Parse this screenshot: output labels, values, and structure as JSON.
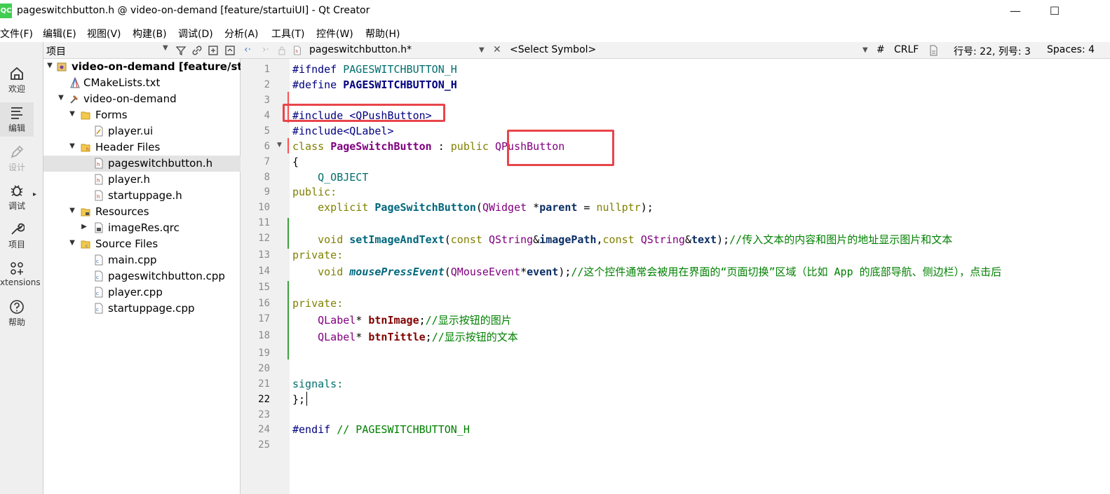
{
  "window": {
    "icon_text": "QC",
    "title": "pageswitchbutton.h @ video-on-demand [feature/startuiUI] - Qt Creator",
    "minimize": "—",
    "maximize": "☐"
  },
  "menu": [
    "文件(F)",
    "编辑(E)",
    "视图(V)",
    "构建(B)",
    "调试(D)",
    "分析(A)",
    "工具(T)",
    "控件(W)",
    "帮助(H)"
  ],
  "modes": [
    {
      "label": "欢迎",
      "icon": "home-icon"
    },
    {
      "label": "编辑",
      "icon": "edit-lines-icon"
    },
    {
      "label": "设计",
      "icon": "pen-icon"
    },
    {
      "label": "调试",
      "icon": "bug-icon"
    },
    {
      "label": "项目",
      "icon": "wrench-icon"
    },
    {
      "label": "xtensions",
      "icon": "extensions-icon"
    },
    {
      "label": "帮助",
      "icon": "help-icon"
    }
  ],
  "project_panel": {
    "combo_label": "项目",
    "tree": [
      {
        "label": "video-on-demand [feature/startuiUI]",
        "bold": true
      },
      {
        "label": "CMakeLists.txt"
      },
      {
        "label": "video-on-demand"
      },
      {
        "label": "Forms"
      },
      {
        "label": "player.ui"
      },
      {
        "label": "Header Files"
      },
      {
        "label": "pageswitchbutton.h",
        "selected": true
      },
      {
        "label": "player.h"
      },
      {
        "label": "startuppage.h"
      },
      {
        "label": "Resources"
      },
      {
        "label": "imageRes.qrc"
      },
      {
        "label": "Source Files"
      },
      {
        "label": "main.cpp"
      },
      {
        "label": "pageswitchbutton.cpp"
      },
      {
        "label": "player.cpp"
      },
      {
        "label": "startuppage.cpp"
      }
    ]
  },
  "editor_toolbar": {
    "file_name": "pageswitchbutton.h*",
    "symbol": "<Select Symbol>",
    "hash": "#",
    "line_ending": "CRLF",
    "position": "行号: 22, 列号: 3",
    "indent": "Spaces: 4"
  },
  "editor": {
    "current_line": 22,
    "line_numbers": [
      "1",
      "2",
      "3",
      "4",
      "5",
      "6",
      "7",
      "8",
      "9",
      "10",
      "11",
      "12",
      "13",
      "14",
      "15",
      "16",
      "17",
      "18",
      "19",
      "20",
      "21",
      "22",
      "23",
      "24",
      "25"
    ],
    "code": {
      "l1_kw": "#ifndef",
      "l1_name": " PAGESWITCHBUTTON_H",
      "l2_kw": "#define",
      "l2_name": " PAGESWITCHBUTTON_H",
      "l4": "#include <QPushButton>",
      "l5": "#include<QLabel>",
      "l6_kw": "class",
      "l6_name": "PageSwitchButton",
      "l6_mid": " : ",
      "l6_pub": "public",
      "l6_base": "QPushButton",
      "l7": "{",
      "l8": "    Q_OBJECT",
      "l9": "public:",
      "l10_kw": "    explicit",
      "l10_fn": "PageSwitchButton",
      "l10_p1": "(",
      "l10_type": "QWidget",
      "l10_p2": " *",
      "l10_var": "parent",
      "l10_p3": " = ",
      "l10_null": "nullptr",
      "l10_end": ");",
      "l12_kw": "    void",
      "l12_fn": "setImageAndText",
      "l12_p1": "(",
      "l12_const1": "const",
      "l12_type1": "QString",
      "l12_amp1": "&",
      "l12_var1": "imagePath",
      "l12_comma": ",",
      "l12_const2": "const",
      "l12_type2": "QString",
      "l12_amp2": "&",
      "l12_var2": "text",
      "l12_end": ");",
      "l12_cmt": "//传入文本的内容和图片的地址显示图片和文本",
      "l13": "private:",
      "l14_kw": "    void",
      "l14_fn": "mousePressEvent",
      "l14_p1": "(",
      "l14_type": "QMouseEvent",
      "l14_star": "*",
      "l14_var": "event",
      "l14_end": ");",
      "l14_cmt": "//这个控件通常会被用在界面的“页面切换”区域（比如 App 的底部导航、侧边栏），点击后",
      "l16": "private:",
      "l17_type": "    QLabel",
      "l17_star": "* ",
      "l17_var": "btnImage",
      "l17_end": ";",
      "l17_cmt": "//显示按钮的图片",
      "l18_type": "    QLabel",
      "l18_star": "* ",
      "l18_var": "btnTittle",
      "l18_end": ";",
      "l18_cmt": "//显示按钮的文本",
      "l21": "signals:",
      "l22": "};",
      "l24_kw": "#endif",
      "l24_cmt": " // PAGESWITCHBUTTON_H"
    }
  }
}
